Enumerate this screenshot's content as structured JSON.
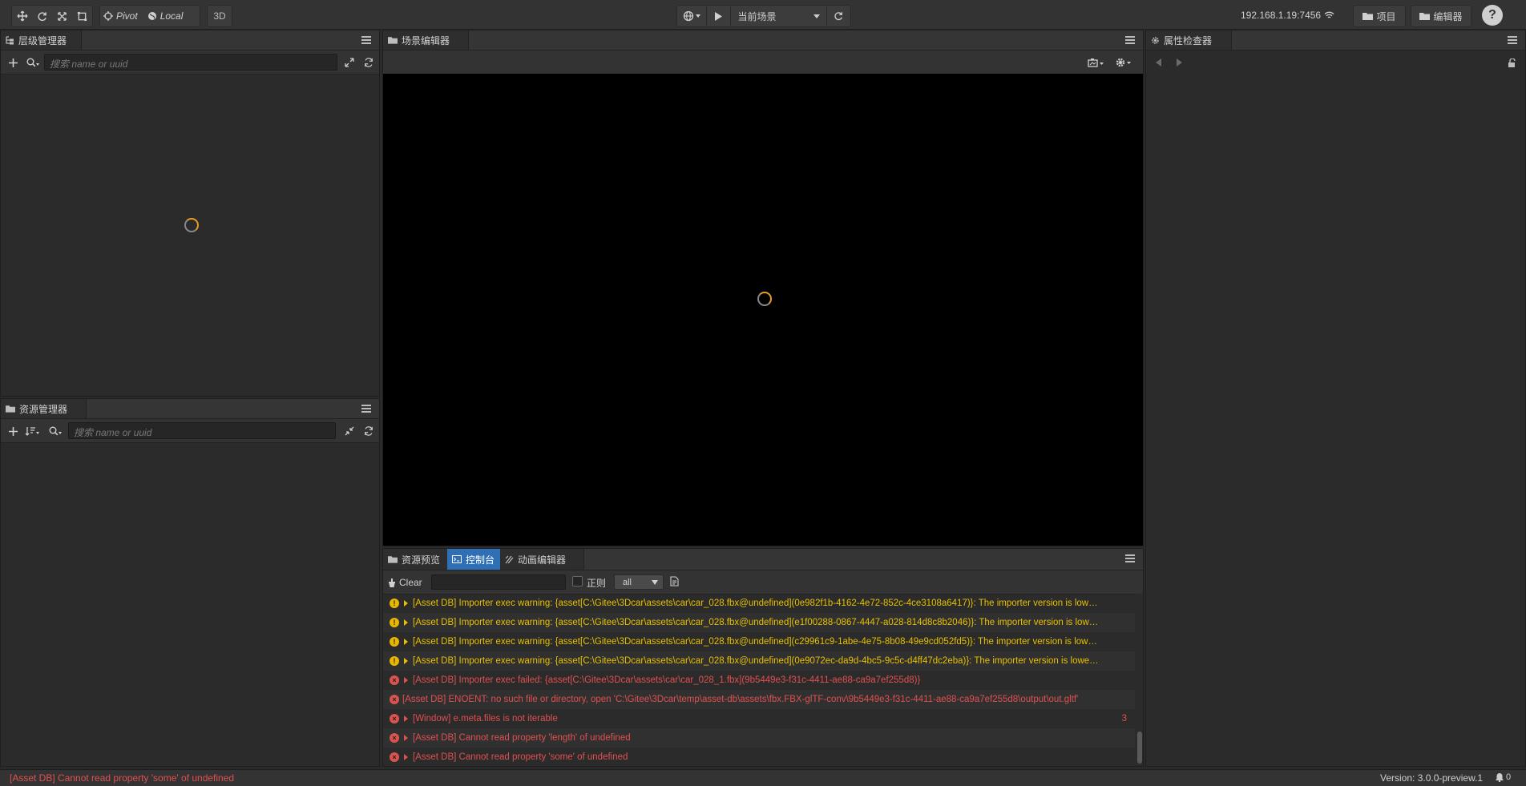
{
  "toolbar": {
    "pivot_label": "Pivot",
    "local_label": "Local",
    "mode_3d_label": "3D",
    "scene_select": "当前场景",
    "ip_address": "192.168.1.19:7456",
    "project_button": "项目",
    "editor_button": "编辑器",
    "help_label": "?"
  },
  "hierarchy": {
    "title": "层级管理器",
    "search_placeholder": "搜索 name or uuid"
  },
  "assets": {
    "title": "资源管理器",
    "search_placeholder": "搜索 name or uuid"
  },
  "scene": {
    "title": "场景编辑器"
  },
  "inspector": {
    "title": "属性检查器"
  },
  "bottom_tabs": [
    {
      "label": "资源预览"
    },
    {
      "label": "控制台"
    },
    {
      "label": "动画编辑器"
    }
  ],
  "console": {
    "clear_label": "Clear",
    "regex_label": "正则",
    "filter_value": "all",
    "rows": [
      {
        "level": "warn",
        "text": "[Asset DB] Importer exec warning: {asset[C:\\Gitee\\3Dcar\\assets\\car\\car_028.fbx@undefined](0e982f1b-4162-4e72-852c-4ce3108a6417)}: The importer version is low…",
        "count": ""
      },
      {
        "level": "warn",
        "text": "[Asset DB] Importer exec warning: {asset[C:\\Gitee\\3Dcar\\assets\\car\\car_028.fbx@undefined](e1f00288-0867-4447-a028-814d8c8b2046)}: The importer version is low…",
        "count": ""
      },
      {
        "level": "warn",
        "text": "[Asset DB] Importer exec warning: {asset[C:\\Gitee\\3Dcar\\assets\\car\\car_028.fbx@undefined](c29961c9-1abe-4e75-8b08-49e9cd052fd5)}: The importer version is low…",
        "count": ""
      },
      {
        "level": "warn",
        "text": "[Asset DB] Importer exec warning: {asset[C:\\Gitee\\3Dcar\\assets\\car\\car_028.fbx@undefined](0e9072ec-da9d-4bc5-9c5c-d4ff47dc2eba)}: The importer version is lowe…",
        "count": ""
      },
      {
        "level": "err",
        "text": "[Asset DB] Importer exec failed: {asset[C:\\Gitee\\3Dcar\\assets\\car\\car_028_1.fbx](9b5449e3-f31c-4411-ae88-ca9a7ef255d8)}",
        "count": ""
      },
      {
        "level": "err",
        "text": "[Asset DB] ENOENT: no such file or directory, open 'C:\\Gitee\\3Dcar\\temp\\asset-db\\assets\\fbx.FBX-glTF-conv\\9b5449e3-f31c-4411-ae88-ca9a7ef255d8\\output\\out.gltf'",
        "count": "",
        "no_arrow": true
      },
      {
        "level": "err",
        "text": "[Window] e.meta.files is not iterable",
        "count": "3"
      },
      {
        "level": "err",
        "text": "[Asset DB] Cannot read property 'length' of undefined",
        "count": ""
      },
      {
        "level": "err",
        "text": "[Asset DB] Cannot read property 'some' of undefined",
        "count": ""
      }
    ]
  },
  "status": {
    "message": "[Asset DB] Cannot read property 'some' of undefined",
    "version": "Version: 3.0.0-preview.1",
    "notify_count": "0"
  },
  "colors": {
    "warning": "#e6c000",
    "error": "#e05050",
    "accent_tab": "#2f6fb5"
  }
}
